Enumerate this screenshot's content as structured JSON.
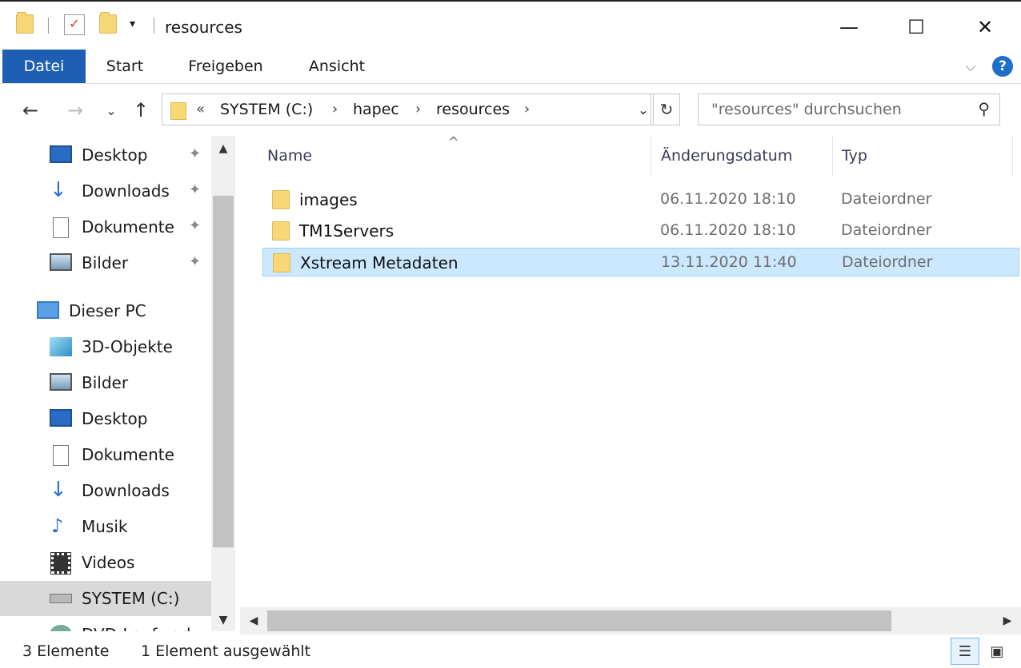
{
  "window": {
    "title": "resources",
    "minimize": "—",
    "maximize": "☐",
    "close": "✕"
  },
  "ribbon": {
    "tabs": [
      "Datei",
      "Start",
      "Freigeben",
      "Ansicht"
    ],
    "expand": "⌵",
    "help": "?"
  },
  "nav": {
    "back": "←",
    "forward": "→",
    "recent": "⌄",
    "up": "↑",
    "address_prefix": "«",
    "breadcrumbs": [
      "SYSTEM (C:)",
      "hapec",
      "resources"
    ],
    "refresh": "↻",
    "search_placeholder": "\"resources\" durchsuchen"
  },
  "sidebar": {
    "quick_access": [
      {
        "label": "Desktop",
        "icon": "desktop-icon",
        "pinned": true
      },
      {
        "label": "Downloads",
        "icon": "downloads-icon",
        "pinned": true
      },
      {
        "label": "Dokumente",
        "icon": "documents-icon",
        "pinned": true
      },
      {
        "label": "Bilder",
        "icon": "pictures-icon",
        "pinned": true
      }
    ],
    "this_pc": {
      "label": "Dieser PC",
      "icon": "computer-icon"
    },
    "pc_items": [
      {
        "label": "3D-Objekte",
        "icon": "3d-objects-icon"
      },
      {
        "label": "Bilder",
        "icon": "pictures-icon"
      },
      {
        "label": "Desktop",
        "icon": "desktop-icon"
      },
      {
        "label": "Dokumente",
        "icon": "documents-icon"
      },
      {
        "label": "Downloads",
        "icon": "downloads-icon"
      },
      {
        "label": "Musik",
        "icon": "music-icon"
      },
      {
        "label": "Videos",
        "icon": "videos-icon"
      },
      {
        "label": "SYSTEM (C:)",
        "icon": "drive-icon",
        "selected": true
      },
      {
        "label": "DVD-Laufwerk (E",
        "icon": "dvd-icon"
      }
    ]
  },
  "content": {
    "columns": [
      "Name",
      "Änderungsdatum",
      "Typ"
    ],
    "sort_indicator": "^",
    "rows": [
      {
        "name": "images",
        "date": "06.11.2020 18:10",
        "type": "Dateiordner",
        "selected": false
      },
      {
        "name": "TM1Servers",
        "date": "06.11.2020 18:10",
        "type": "Dateiordner",
        "selected": false
      },
      {
        "name": "Xstream Metadaten",
        "date": "13.11.2020 11:40",
        "type": "Dateiordner",
        "selected": true
      }
    ]
  },
  "status": {
    "count": "3 Elemente",
    "selection": "1 Element ausgewählt"
  },
  "colors": {
    "accent": "#1e5fb4",
    "selection_bg": "#cce8ff",
    "selection_border": "#99d1ff",
    "folder": "#f8d775"
  }
}
